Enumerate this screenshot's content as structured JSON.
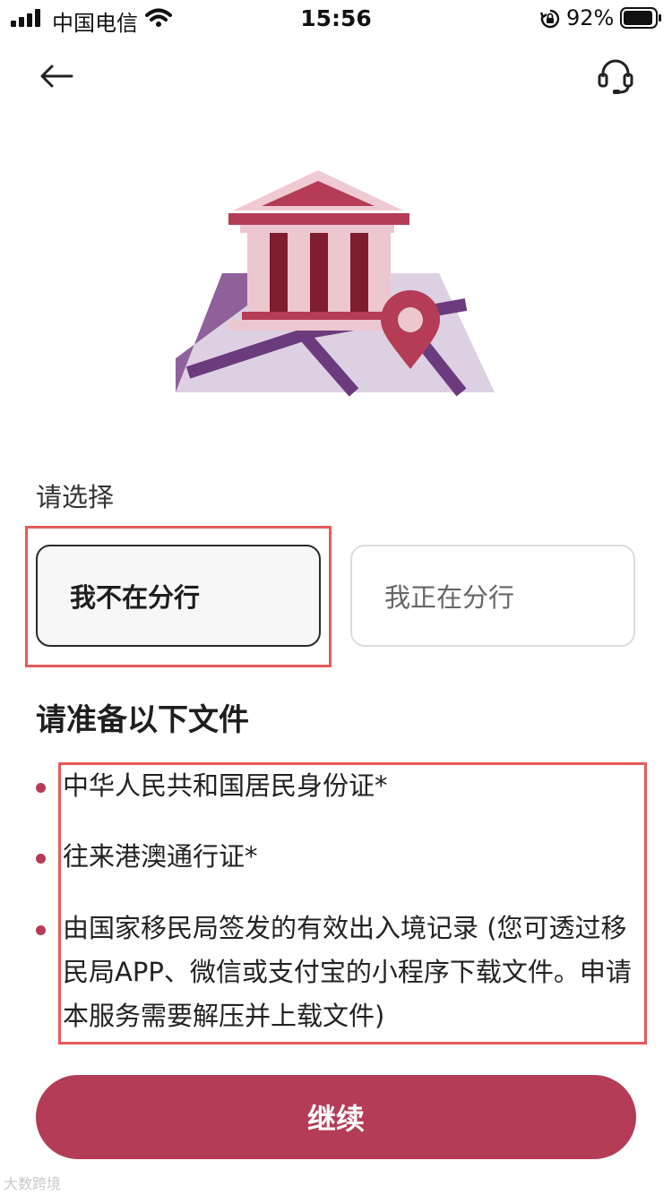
{
  "status_bar": {
    "carrier": "中国电信",
    "time": "15:56",
    "battery": "92%"
  },
  "nav": {
    "back_icon": "arrow-left-icon",
    "support_icon": "headset-icon"
  },
  "illustration": {
    "icon": "bank-map-illustration",
    "colors": {
      "primary": "#b43c57",
      "dark": "#7d1d2e",
      "light": "#ecc7d0",
      "map_light": "#ddd0e3",
      "map_road": "#6c3b7d"
    }
  },
  "selection": {
    "prompt": "请选择",
    "options": [
      {
        "label": "我不在分行",
        "selected": true
      },
      {
        "label": "我正在分行",
        "selected": false
      }
    ]
  },
  "documents": {
    "heading": "请准备以下文件",
    "items": [
      "中华人民共和国居民身份证*",
      "往来港澳通行证*",
      "由国家移民局签发的有效出入境记录 (您可透过移民局APP、微信或支付宝的小程序下载文件。申请本服务需要解压并上载文件)"
    ]
  },
  "cta": {
    "label": "继续",
    "color": "#b43c57"
  },
  "watermark": "大数跨境"
}
